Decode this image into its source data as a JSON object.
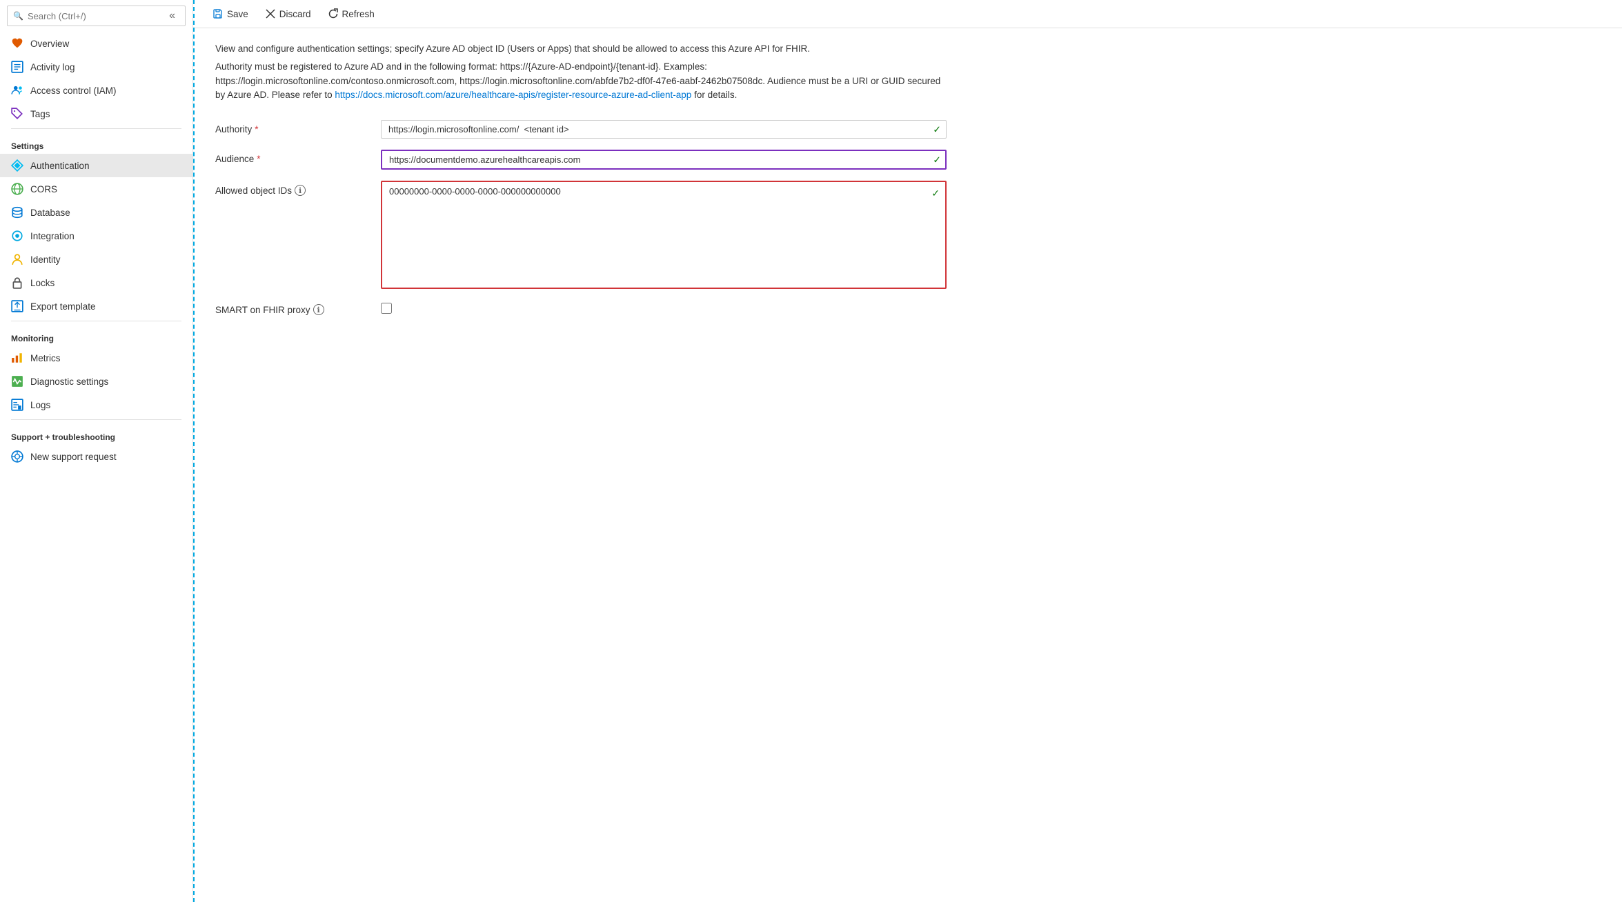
{
  "search": {
    "placeholder": "Search (Ctrl+/)"
  },
  "sidebar": {
    "top_items": [
      {
        "id": "overview",
        "label": "Overview",
        "icon": "heart"
      },
      {
        "id": "activity-log",
        "label": "Activity log",
        "icon": "activity"
      },
      {
        "id": "access-control",
        "label": "Access control (IAM)",
        "icon": "people"
      },
      {
        "id": "tags",
        "label": "Tags",
        "icon": "tag"
      }
    ],
    "settings_section": "Settings",
    "settings_items": [
      {
        "id": "authentication",
        "label": "Authentication",
        "icon": "diamond",
        "active": true
      },
      {
        "id": "cors",
        "label": "CORS",
        "icon": "cors"
      },
      {
        "id": "database",
        "label": "Database",
        "icon": "database"
      },
      {
        "id": "integration",
        "label": "Integration",
        "icon": "integration"
      },
      {
        "id": "identity",
        "label": "Identity",
        "icon": "identity"
      },
      {
        "id": "locks",
        "label": "Locks",
        "icon": "lock"
      },
      {
        "id": "export-template",
        "label": "Export template",
        "icon": "export"
      }
    ],
    "monitoring_section": "Monitoring",
    "monitoring_items": [
      {
        "id": "metrics",
        "label": "Metrics",
        "icon": "metrics"
      },
      {
        "id": "diagnostic-settings",
        "label": "Diagnostic settings",
        "icon": "diagnostic"
      },
      {
        "id": "logs",
        "label": "Logs",
        "icon": "logs"
      }
    ],
    "support_section": "Support + troubleshooting",
    "support_items": [
      {
        "id": "new-support-request",
        "label": "New support request",
        "icon": "support"
      }
    ]
  },
  "toolbar": {
    "save_label": "Save",
    "discard_label": "Discard",
    "refresh_label": "Refresh"
  },
  "main": {
    "description1": "View and configure authentication settings; specify Azure AD object ID (Users or Apps) that should be allowed to access this Azure API for FHIR.",
    "description2_before": "Authority must be registered to Azure AD and in the following format: https://{Azure-AD-endpoint}/{tenant-id}. Examples: https://login.microsoftonline.com/contoso.onmicrosoft.com, https://login.microsoftonline.com/abfde7b2-df0f-47e6-aabf-2462b07508dc. Audience must be a URI or GUID secured by Azure AD. Please refer to ",
    "description2_link": "https://docs.microsoft.com/azure/healthcare-apis/register-resource-azure-ad-client-app",
    "description2_link_text": "https://docs.microsoft.com/azure/healthcare-apis/register-resource-azure-ad-client-app",
    "description2_after": " for details.",
    "authority_label": "Authority",
    "authority_value": "https://login.microsoftonline.com/  <tenant id>",
    "audience_label": "Audience",
    "audience_value": "https://documentdemo.azurehealthcareapis.com",
    "allowed_object_ids_label": "Allowed object IDs",
    "allowed_object_ids_value": "00000000-0000-0000-0000-000000000000",
    "smart_proxy_label": "SMART on FHIR proxy",
    "check_mark": "✓"
  }
}
